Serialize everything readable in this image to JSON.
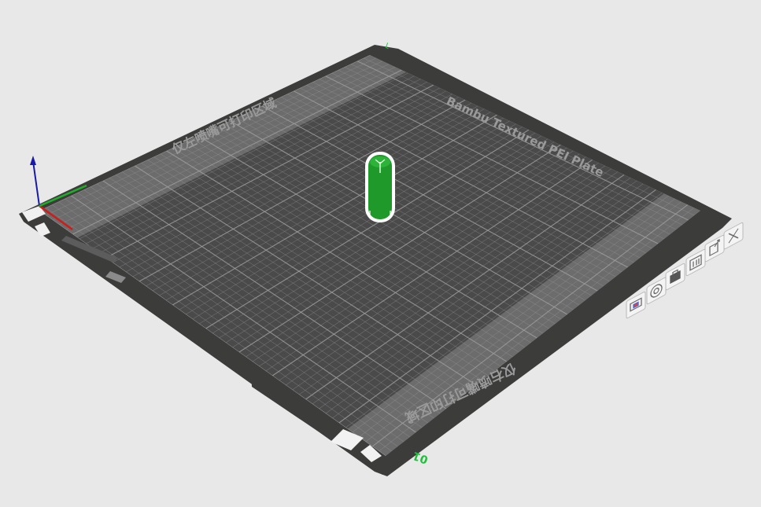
{
  "plate": {
    "name_text": "Bambu Textured PEI Plate",
    "left_zone_text": "仅左喷嘴可打印区域",
    "right_zone_text": "仅右喷嘴可打印区域",
    "corner_label": "01"
  },
  "colors": {
    "background": "#e8e8e8",
    "plate_frame": "#3c3d3b",
    "plate_surface": "#4a4a4a",
    "zone_band": "#6c6c6c",
    "grid_line": "#9c9c9c",
    "object": "#1f9a2a",
    "axis_x": "#d11a1a",
    "axis_y": "#1fae2a",
    "axis_z": "#1a1aa8",
    "accent_green": "#1fbf3a"
  },
  "toolbar": {
    "buttons": [
      {
        "name": "arrange-button",
        "icon": "arrange-icon"
      },
      {
        "name": "orient-button",
        "icon": "orient-icon"
      },
      {
        "name": "lock-plate-button",
        "icon": "lock-icon"
      },
      {
        "name": "plate-settings-button",
        "icon": "settings-icon"
      },
      {
        "name": "move-plate-button",
        "icon": "move-icon"
      },
      {
        "name": "delete-plate-button",
        "icon": "close-icon"
      }
    ]
  }
}
